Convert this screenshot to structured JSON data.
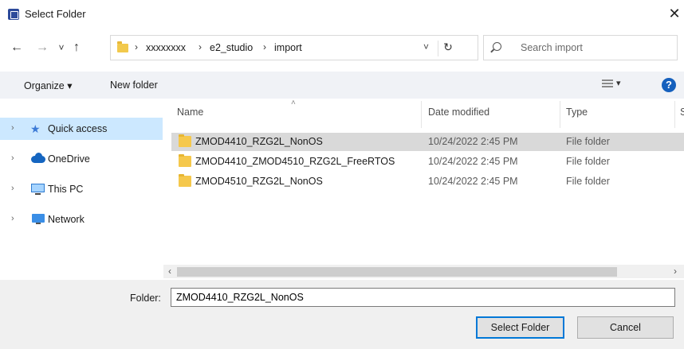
{
  "window": {
    "title": "Select Folder",
    "close_glyph": "✕"
  },
  "nav_buttons": {
    "back": "←",
    "forward": "→",
    "recent": "˅",
    "up": "↑"
  },
  "address": {
    "crumbs": [
      "xxxxxxxx",
      "e2_studio",
      "import"
    ],
    "separator": "›",
    "dropdown_glyph": "˅",
    "refresh_glyph": "↻"
  },
  "search": {
    "placeholder": "Search import"
  },
  "toolbar": {
    "organize": "Organize ▾",
    "new_folder": "New folder",
    "view_dropdown": "▾",
    "help": "?"
  },
  "sidebar": {
    "items": [
      {
        "label": "Quick access",
        "icon": "star-icon",
        "selected": true
      },
      {
        "label": "OneDrive",
        "icon": "cloud-icon",
        "selected": false
      },
      {
        "label": "This PC",
        "icon": "computer-icon",
        "selected": false
      },
      {
        "label": "Network",
        "icon": "network-icon",
        "selected": false
      }
    ],
    "chevron": "›"
  },
  "columns": {
    "name": "Name",
    "date": "Date modified",
    "type": "Type",
    "size": "S",
    "sort_glyph": "˄"
  },
  "files": [
    {
      "name": "ZMOD4410_RZG2L_NonOS",
      "date": "10/24/2022 2:45 PM",
      "type": "File folder",
      "selected": true
    },
    {
      "name": "ZMOD4410_ZMOD4510_RZG2L_FreeRTOS",
      "date": "10/24/2022 2:45 PM",
      "type": "File folder",
      "selected": false
    },
    {
      "name": "ZMOD4510_RZG2L_NonOS",
      "date": "10/24/2022 2:45 PM",
      "type": "File folder",
      "selected": false
    }
  ],
  "scrollbar": {
    "left": "‹",
    "right": "›"
  },
  "footer": {
    "folder_label": "Folder:",
    "folder_value": "ZMOD4410_RZG2L_NonOS",
    "select_button": "Select Folder",
    "cancel_button": "Cancel"
  },
  "colors": {
    "selection": "#cce8ff",
    "row_selected": "#d9d9d9",
    "accent": "#0078d7",
    "folder": "#f5c84c"
  }
}
